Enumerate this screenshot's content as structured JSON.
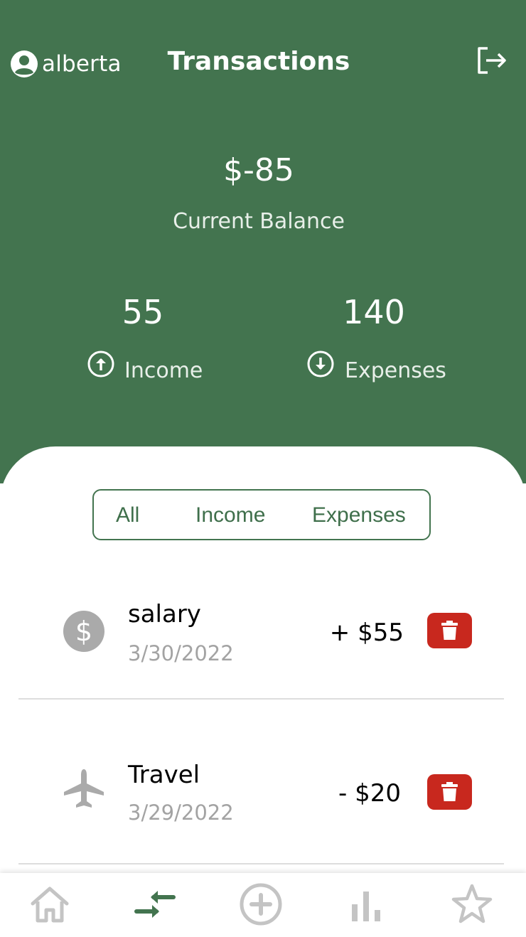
{
  "header": {
    "username": "alberta",
    "title": "Transactions",
    "balance": "$-85",
    "balance_label": "Current Balance",
    "income_value": "55",
    "income_label": "Income",
    "expenses_value": "140",
    "expenses_label": "Expenses"
  },
  "filter": {
    "tabs": [
      "All",
      "Income",
      "Expenses"
    ],
    "selected": "All"
  },
  "transactions": [
    {
      "name": "salary",
      "date": "3/30/2022",
      "amount": "+ $55",
      "icon": "dollar-icon"
    },
    {
      "name": "Travel",
      "date": "3/29/2022",
      "amount": "- $20",
      "icon": "airplane-icon"
    }
  ],
  "nav": {
    "items": [
      "home-icon",
      "transactions-icon",
      "add-icon",
      "stats-icon",
      "star-icon"
    ],
    "active": "transactions-icon"
  },
  "colors": {
    "primary": "#43744f",
    "delete": "#c8281e",
    "inactive_icon": "#c4c4c4",
    "muted_text": "#a3a3a3"
  }
}
